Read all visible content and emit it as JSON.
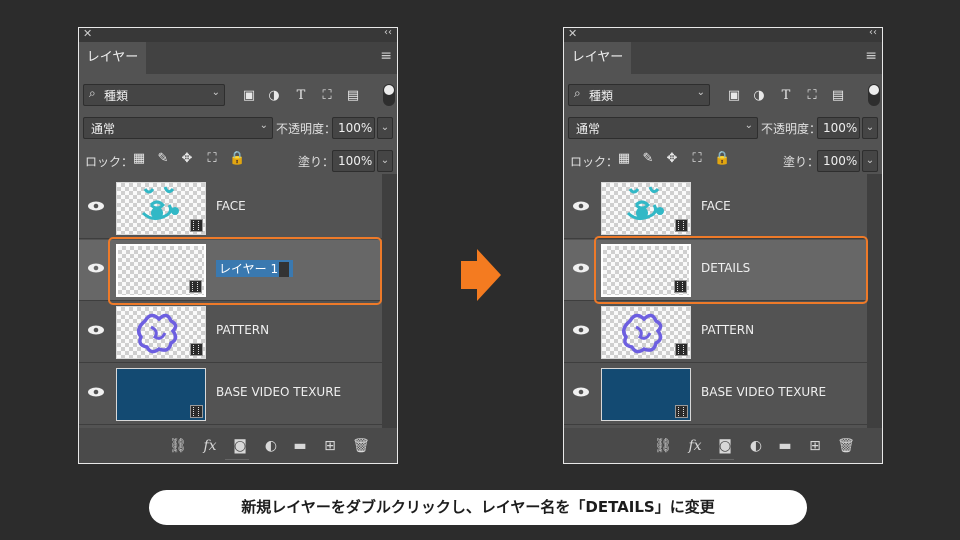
{
  "panel": {
    "tab_label": "レイヤー",
    "filter_label": "種類",
    "blend_mode": "通常",
    "opacity_label": "不透明度：",
    "opacity_value": "100%",
    "lock_label": "ロック：",
    "fill_label": "塗り：",
    "fill_value": "100%"
  },
  "left_panel": {
    "layers": [
      {
        "name": "FACE",
        "thumb": "face"
      },
      {
        "name": "レイヤー 1",
        "thumb": "empty",
        "editing": true,
        "selected": true
      },
      {
        "name": "PATTERN",
        "thumb": "pattern"
      },
      {
        "name": "BASE VIDEO TEXURE",
        "thumb": "blue"
      }
    ]
  },
  "right_panel": {
    "layers": [
      {
        "name": "FACE",
        "thumb": "face"
      },
      {
        "name": "DETAILS",
        "thumb": "empty",
        "selected": true
      },
      {
        "name": "PATTERN",
        "thumb": "pattern"
      },
      {
        "name": "BASE VIDEO TEXURE",
        "thumb": "blue"
      }
    ]
  },
  "bottom_icons": [
    "link-icon",
    "fx-icon",
    "mask-icon",
    "adjustment-icon",
    "folder-icon",
    "new-layer-icon",
    "trash-icon"
  ],
  "fx_label": "fx",
  "caption": "新規レイヤーをダブルクリックし、レイヤー名を「DETAILS」に変更",
  "colors": {
    "highlight": "#ee7a29",
    "arrow": "#f47b20",
    "panel": "#535353",
    "background": "#2c2c2c"
  }
}
